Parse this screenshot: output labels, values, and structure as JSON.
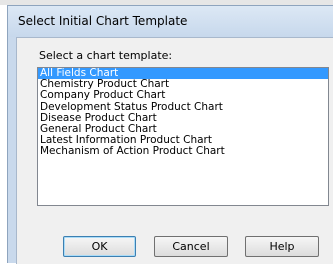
{
  "window": {
    "title": "Select Initial Chart Template"
  },
  "prompt": {
    "label": "Select a chart template:"
  },
  "templates": {
    "selected_index": 0,
    "items": [
      "All Fields Chart",
      "Chemistry Product Chart",
      "Company Product Chart",
      "Development Status Product Chart",
      "Disease Product Chart",
      "General Product Chart",
      "Latest Information Product Chart",
      "Mechanism of Action Product Chart"
    ]
  },
  "buttons": {
    "ok_label": "OK",
    "cancel_label": "Cancel",
    "help_label": "Help"
  },
  "colors": {
    "selection": "#3399ff",
    "title_bar": "#c9d9ec",
    "dialog_face": "#f0f0f0"
  }
}
